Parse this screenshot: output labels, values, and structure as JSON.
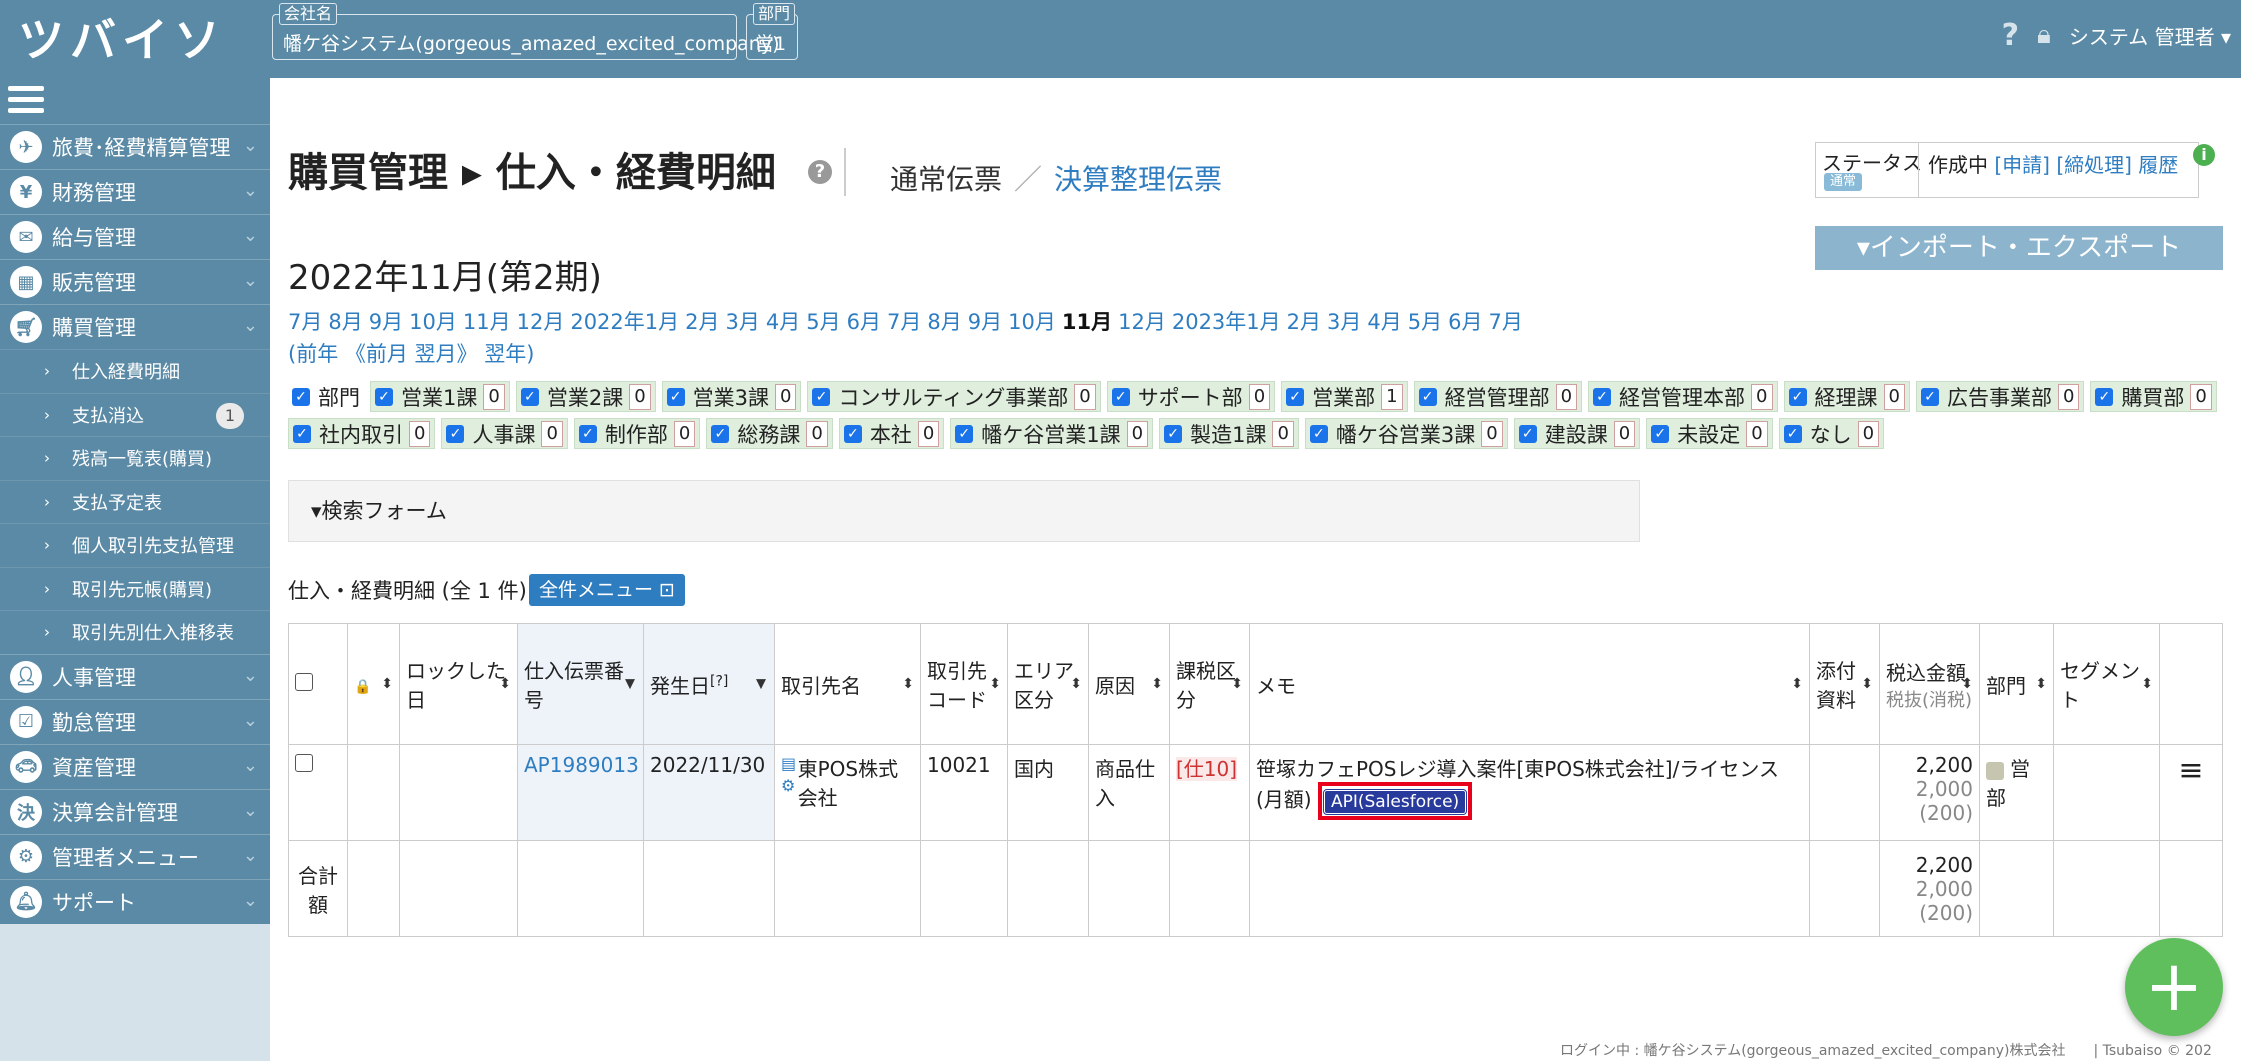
{
  "header": {
    "logo": "ツバイソ",
    "company_label": "会社名",
    "company_value": "幡ケ谷システム(gorgeous_amazed_excited_company)",
    "dept_label": "部門",
    "dept_value": "営1",
    "user": "システム 管理者",
    "help_icon": "question-icon",
    "lock_icon": "lock-icon"
  },
  "sidebar": {
    "items": [
      {
        "label": "旅費･経費精算管理",
        "icon": "airplane-icon"
      },
      {
        "label": "財務管理",
        "icon": "yen-icon"
      },
      {
        "label": "給与管理",
        "icon": "envelope-icon"
      },
      {
        "label": "販売管理",
        "icon": "building-icon"
      },
      {
        "label": "購買管理",
        "icon": "cart-icon"
      }
    ],
    "subitems": [
      {
        "label": "仕入経費明細"
      },
      {
        "label": "支払消込",
        "badge": "1"
      },
      {
        "label": "残高一覧表(購買)"
      },
      {
        "label": "支払予定表"
      },
      {
        "label": "個人取引先支払管理"
      },
      {
        "label": "取引先元帳(購買)"
      },
      {
        "label": "取引先別仕入推移表"
      }
    ],
    "items2": [
      {
        "label": "人事管理",
        "icon": "person-icon"
      },
      {
        "label": "勤怠管理",
        "icon": "calendar-check-icon"
      },
      {
        "label": "資産管理",
        "icon": "car-icon"
      },
      {
        "label": "決算会計管理",
        "icon": "settlement-icon"
      },
      {
        "label": "管理者メニュー",
        "icon": "gears-icon"
      },
      {
        "label": "サポート",
        "icon": "bell-icon"
      }
    ]
  },
  "page": {
    "title": "購買管理 ▸ 仕入・経費明細",
    "slip_normal": "通常伝票",
    "slip_sep": "／",
    "slip_settlement": "決算整理伝票",
    "status_label": "ステータス",
    "status_chip": "通常",
    "status_text": "作成中",
    "status_apply": "[申請]",
    "status_close": "[締処理]",
    "status_history": "履歴",
    "import_export": "▾インポート・エクスポート",
    "period_title": "2022年11月(第2期)",
    "months": [
      "7月",
      "8月",
      "9月",
      "10月",
      "11月",
      "12月",
      "2022年1月",
      "2月",
      "3月",
      "4月",
      "5月",
      "6月",
      "7月",
      "8月",
      "9月",
      "10月",
      "11月",
      "12月",
      "2023年1月",
      "2月",
      "3月",
      "4月",
      "5月",
      "6月",
      "7月"
    ],
    "current_month_index": 16,
    "year_nav": "(前年 《前月 翌月》 翌年)",
    "dept_master_label": "部門",
    "departments": [
      {
        "name": "営業1課",
        "count": "0"
      },
      {
        "name": "営業2課",
        "count": "0"
      },
      {
        "name": "営業3課",
        "count": "0"
      },
      {
        "name": "コンサルティング事業部",
        "count": "0"
      },
      {
        "name": "サポート部",
        "count": "0"
      },
      {
        "name": "営業部",
        "count": "1"
      },
      {
        "name": "経営管理部",
        "count": "0"
      },
      {
        "name": "経営管理本部",
        "count": "0"
      },
      {
        "name": "経理課",
        "count": "0"
      },
      {
        "name": "広告事業部",
        "count": "0"
      },
      {
        "name": "購買部",
        "count": "0"
      },
      {
        "name": "社内取引",
        "count": "0"
      },
      {
        "name": "人事課",
        "count": "0"
      },
      {
        "name": "制作部",
        "count": "0"
      },
      {
        "name": "総務課",
        "count": "0"
      },
      {
        "name": "本社",
        "count": "0"
      },
      {
        "name": "幡ケ谷営業1課",
        "count": "0"
      },
      {
        "name": "製造1課",
        "count": "0"
      },
      {
        "name": "幡ケ谷営業3課",
        "count": "0"
      },
      {
        "name": "建設課",
        "count": "0"
      },
      {
        "name": "未設定",
        "count": "0"
      },
      {
        "name": "なし",
        "count": "0"
      }
    ],
    "search_form": "▾検索フォーム",
    "list_heading": "仕入・経費明細 (全 1 件)",
    "all_menu": "全件メニュー ⊡"
  },
  "table": {
    "headers": {
      "lock": "🔒",
      "locked_date": "ロックした日",
      "slip_no": "仕入伝票番号",
      "issue_date": "発生日",
      "issue_help": "[?]",
      "partner": "取引先名",
      "partner_code": "取引先コード",
      "area": "エリア区分",
      "cause": "原因",
      "tax_class": "課税区分",
      "memo": "メモ",
      "attachment": "添付資料",
      "amount": "税込金額",
      "amount_sub": "税抜(消税)",
      "dept": "部門",
      "segment": "セグメント"
    },
    "row": {
      "slip_no": "AP1989013",
      "issue_date": "2022/11/30",
      "partner": "東POS株式会社",
      "partner_code": "10021",
      "area": "国内",
      "cause": "商品仕入",
      "tax_class": "[仕10]",
      "memo": "笹塚カフェPOSレジ導入案件[東POS株式会社]/ライセンス(月額)",
      "api_tag": "API(Salesforce)",
      "amount": "2,200",
      "amount_ex": "2,000",
      "amount_tax": "(200)",
      "dept": "営部"
    },
    "total": {
      "label": "合計額",
      "amount": "2,200",
      "amount_ex": "2,000",
      "amount_tax": "(200)"
    }
  },
  "footer": "ログイン中 : 幡ケ谷システム(gorgeous_amazed_excited_company)株式会社　　| Tsubaiso © 202",
  "fab": "+"
}
